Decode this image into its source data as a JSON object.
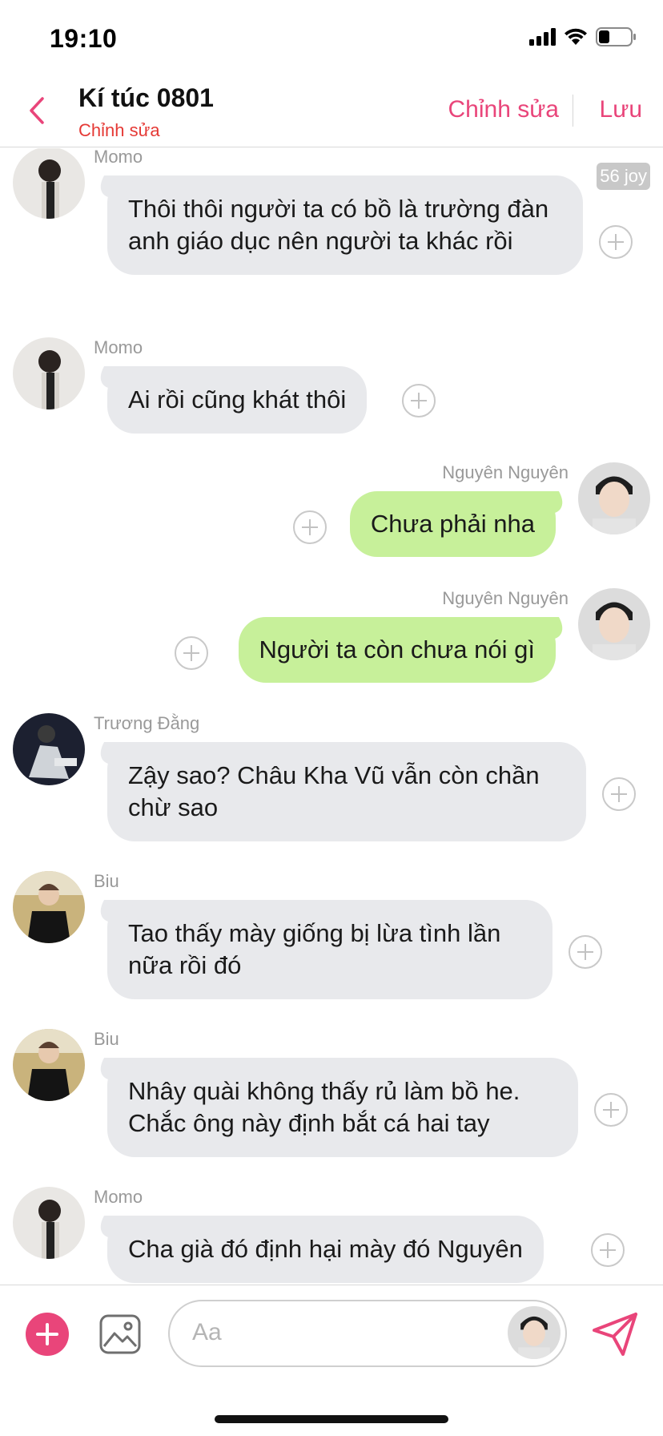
{
  "status_bar": {
    "time": "19:10"
  },
  "header": {
    "title": "Kí túc 0801",
    "subtitle": "Chỉnh sửa",
    "edit_label": "Chỉnh sửa",
    "save_label": "Lưu"
  },
  "timestamp_badge": "56 joy",
  "messages": [
    {
      "sender": "Momo",
      "text": "Thôi thôi người ta có bồ là trường đàn anh giáo dục nên người ta khác rồi",
      "direction": "incoming"
    },
    {
      "sender": "Momo",
      "text": "Ai rồi cũng khát thôi",
      "direction": "incoming"
    },
    {
      "sender": "Nguyên Nguyên",
      "text": "Chưa phải nha",
      "direction": "outgoing"
    },
    {
      "sender": "Nguyên Nguyên",
      "text": "Người ta còn chưa nói gì",
      "direction": "outgoing"
    },
    {
      "sender": "Trương Đằng",
      "text": "Zậy sao? Châu Kha Vũ vẫn còn chần chừ sao",
      "direction": "incoming"
    },
    {
      "sender": "Biu",
      "text": "Tao thấy mày giống bị lừa tình lần nữa rồi đó",
      "direction": "incoming"
    },
    {
      "sender": "Biu",
      "text": "Nhây quài không thấy rủ làm bồ he. Chắc ông này định bắt cá hai tay",
      "direction": "incoming"
    },
    {
      "sender": "Momo",
      "text": "Cha già đó định hại mày đó Nguyên",
      "direction": "incoming"
    }
  ],
  "input": {
    "placeholder": "Aa"
  },
  "colors": {
    "accent": "#e9457a",
    "incoming_bubble": "#e8e9ec",
    "outgoing_bubble": "#c7f09a",
    "subtitle": "#e53935"
  },
  "icons": {
    "back": "chevron-left-icon",
    "add": "plus-icon",
    "image": "image-icon",
    "send": "send-icon",
    "react": "add-reaction-icon"
  }
}
